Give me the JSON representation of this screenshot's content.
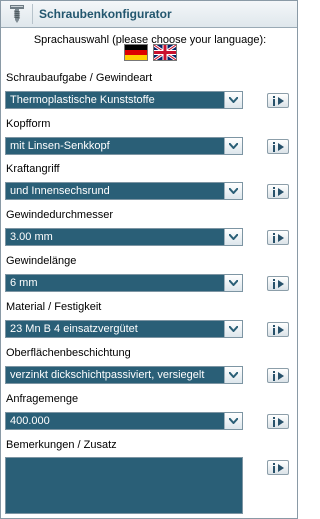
{
  "header": {
    "title": "Schraubenkonfigurator",
    "icon": "screw-icon"
  },
  "language": {
    "label": "Sprachauswahl (please choose your language):",
    "flags": [
      "german-flag-icon",
      "uk-flag-icon"
    ]
  },
  "fields": [
    {
      "label": "Schraubaufgabe / Gewindeart",
      "value": "Thermoplastische Kunststoffe"
    },
    {
      "label": "Kopfform",
      "value": "mit Linsen-Senkkopf"
    },
    {
      "label": "Kraftangriff",
      "value": "und Innensechsrund"
    },
    {
      "label": "Gewindedurchmesser",
      "value": "3.00 mm"
    },
    {
      "label": "Gewindelänge",
      "value": "6 mm"
    },
    {
      "label": "Material / Festigkeit",
      "value": "23 Mn B 4 einsatzvergütet"
    },
    {
      "label": "Oberflächenbeschichtung",
      "value": "verzinkt dickschichtpassiviert, versiegelt"
    },
    {
      "label": "Anfragemenge",
      "value": "400.000"
    }
  ],
  "remarks": {
    "label": "Bemerkungen / Zusatz",
    "value": ""
  },
  "colors": {
    "field_bg": "#2a5f77",
    "title": "#22566e"
  }
}
